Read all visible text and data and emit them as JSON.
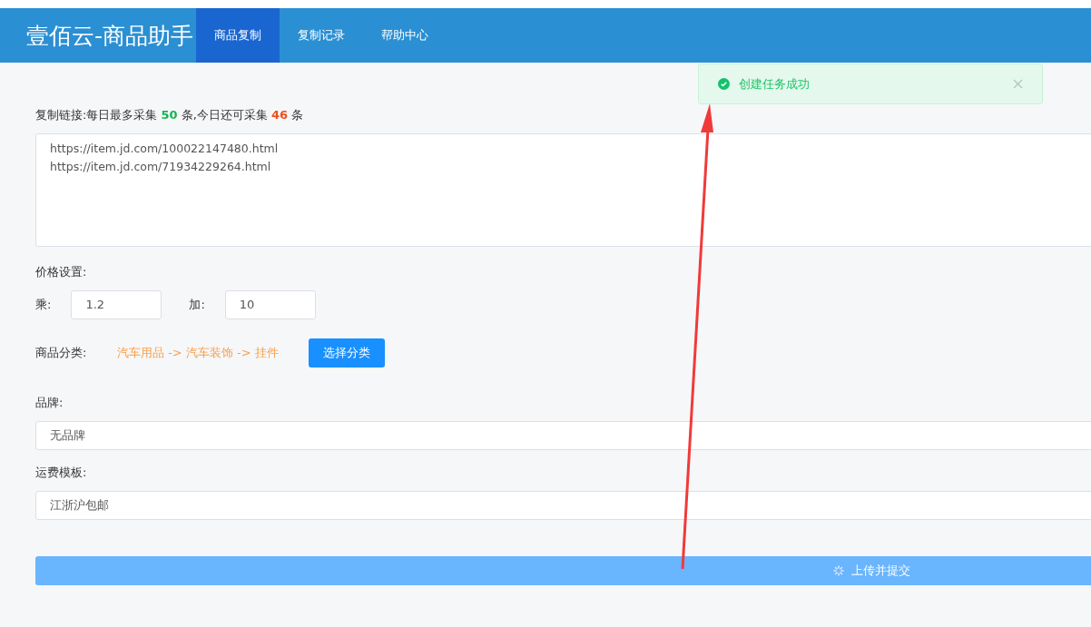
{
  "header": {
    "title": "壹佰云-商品助手",
    "tabs": [
      {
        "label": "商品复制",
        "selected": true
      },
      {
        "label": "复制记录",
        "selected": false
      },
      {
        "label": "帮助中心",
        "selected": false
      }
    ]
  },
  "toast": {
    "kind": "success",
    "message": "创建任务成功",
    "closable": true
  },
  "form": {
    "links_label": "复制链接:每日最多采集 **50** 条,今日还可采集 **46** 条",
    "links": [
      "https://item.jd.com/100022147480.html",
      "https://item.jd.com/71934229264.html"
    ],
    "price_label": "价格设置:",
    "multiply_label": "乘:",
    "multiply_value": "1.2",
    "add_label": "加:",
    "add_value": "10",
    "category_label": "商品分类:",
    "category_value": "汽车用品 -> 汽车装饰 -> 挂件",
    "category_button": "选择分类",
    "brand_label": "品牌:",
    "brand_value": "无品牌",
    "shipping_label": "运费模板:",
    "shipping_value": "江浙沪包邮",
    "submit": {
      "label": "上传并提交",
      "loading": true
    }
  }
}
